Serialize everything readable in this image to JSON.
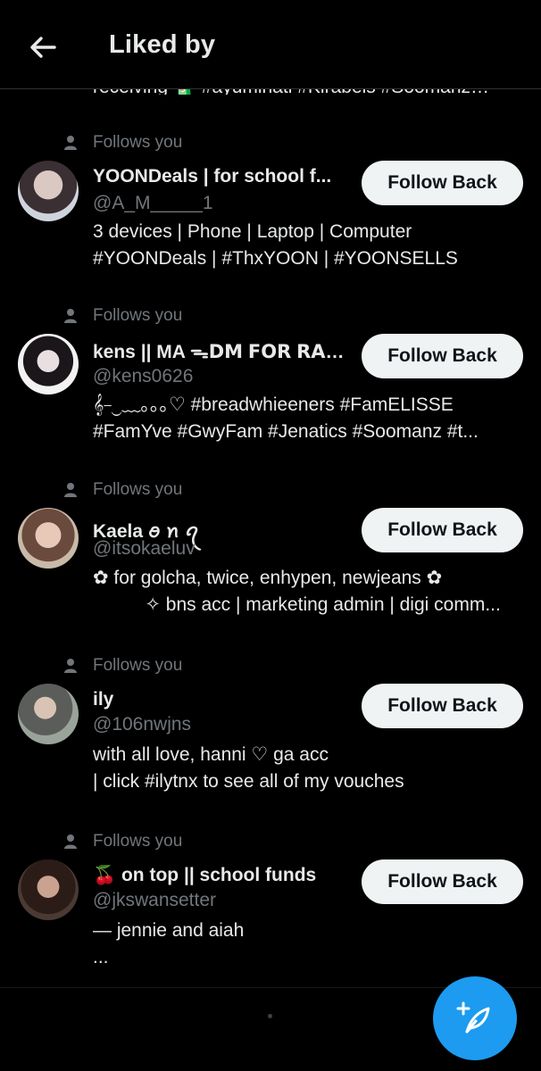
{
  "header": {
    "title": "Liked by",
    "back_icon": "arrow-left-icon"
  },
  "cut_bio": "receiving 🧃 #ayuminati #Kirabels #Soomanz…",
  "colors": {
    "background": "#000000",
    "secondary_text": "#71767b",
    "button_bg": "#eff3f4",
    "accent": "#1d9bf0"
  },
  "users": [
    {
      "follows_label": "Follows you",
      "name": "YOONDeals | for school f...",
      "handle": "@A_M_____1",
      "bio": [
        "3 devices | Phone | Laptop | Computer",
        "#YOONDeals | #ThxYOON | #YOONSELLS"
      ],
      "button": "Follow Back"
    },
    {
      "follows_label": "Follows you",
      "name": "kens || MA ᯓ𝗗𝗠 𝗙𝗢𝗥 𝗥𝗔𝗧𝗘𝗦 ...",
      "handle": "@kens0626",
      "bio": [
        "𝄞⎯⏝﹏｡｡｡♡ #breadwhieeners #FamELISSE",
        "#FamYve #GwyFam #Jenatics  #Soomanz #t..."
      ],
      "button": "Follow Back"
    },
    {
      "follows_label": "Follows you",
      "name": "Kaela ꪮ ꪀ ꪖ",
      "handle": "@itsokaeluv",
      "bio": [
        "✿ for golcha, twice, enhypen, newjeans ✿",
        "          ✧ bns acc | marketing admin | digi comm..."
      ],
      "button": "Follow Back"
    },
    {
      "follows_label": "Follows you",
      "name": "ily",
      "handle": "@106nwjns",
      "bio": [
        "with all love, hanni ♡ ga acc",
        "| click #ilytnx to see all of my vouches"
      ],
      "button": "Follow Back"
    },
    {
      "follows_label": "Follows you",
      "name": "🍒 on top || school funds",
      "handle": "@jkswansetter",
      "bio": [
        "— jennie and aiah",
        "..."
      ],
      "button": "Follow Back"
    }
  ],
  "fab": {
    "icon": "compose-post-icon"
  }
}
